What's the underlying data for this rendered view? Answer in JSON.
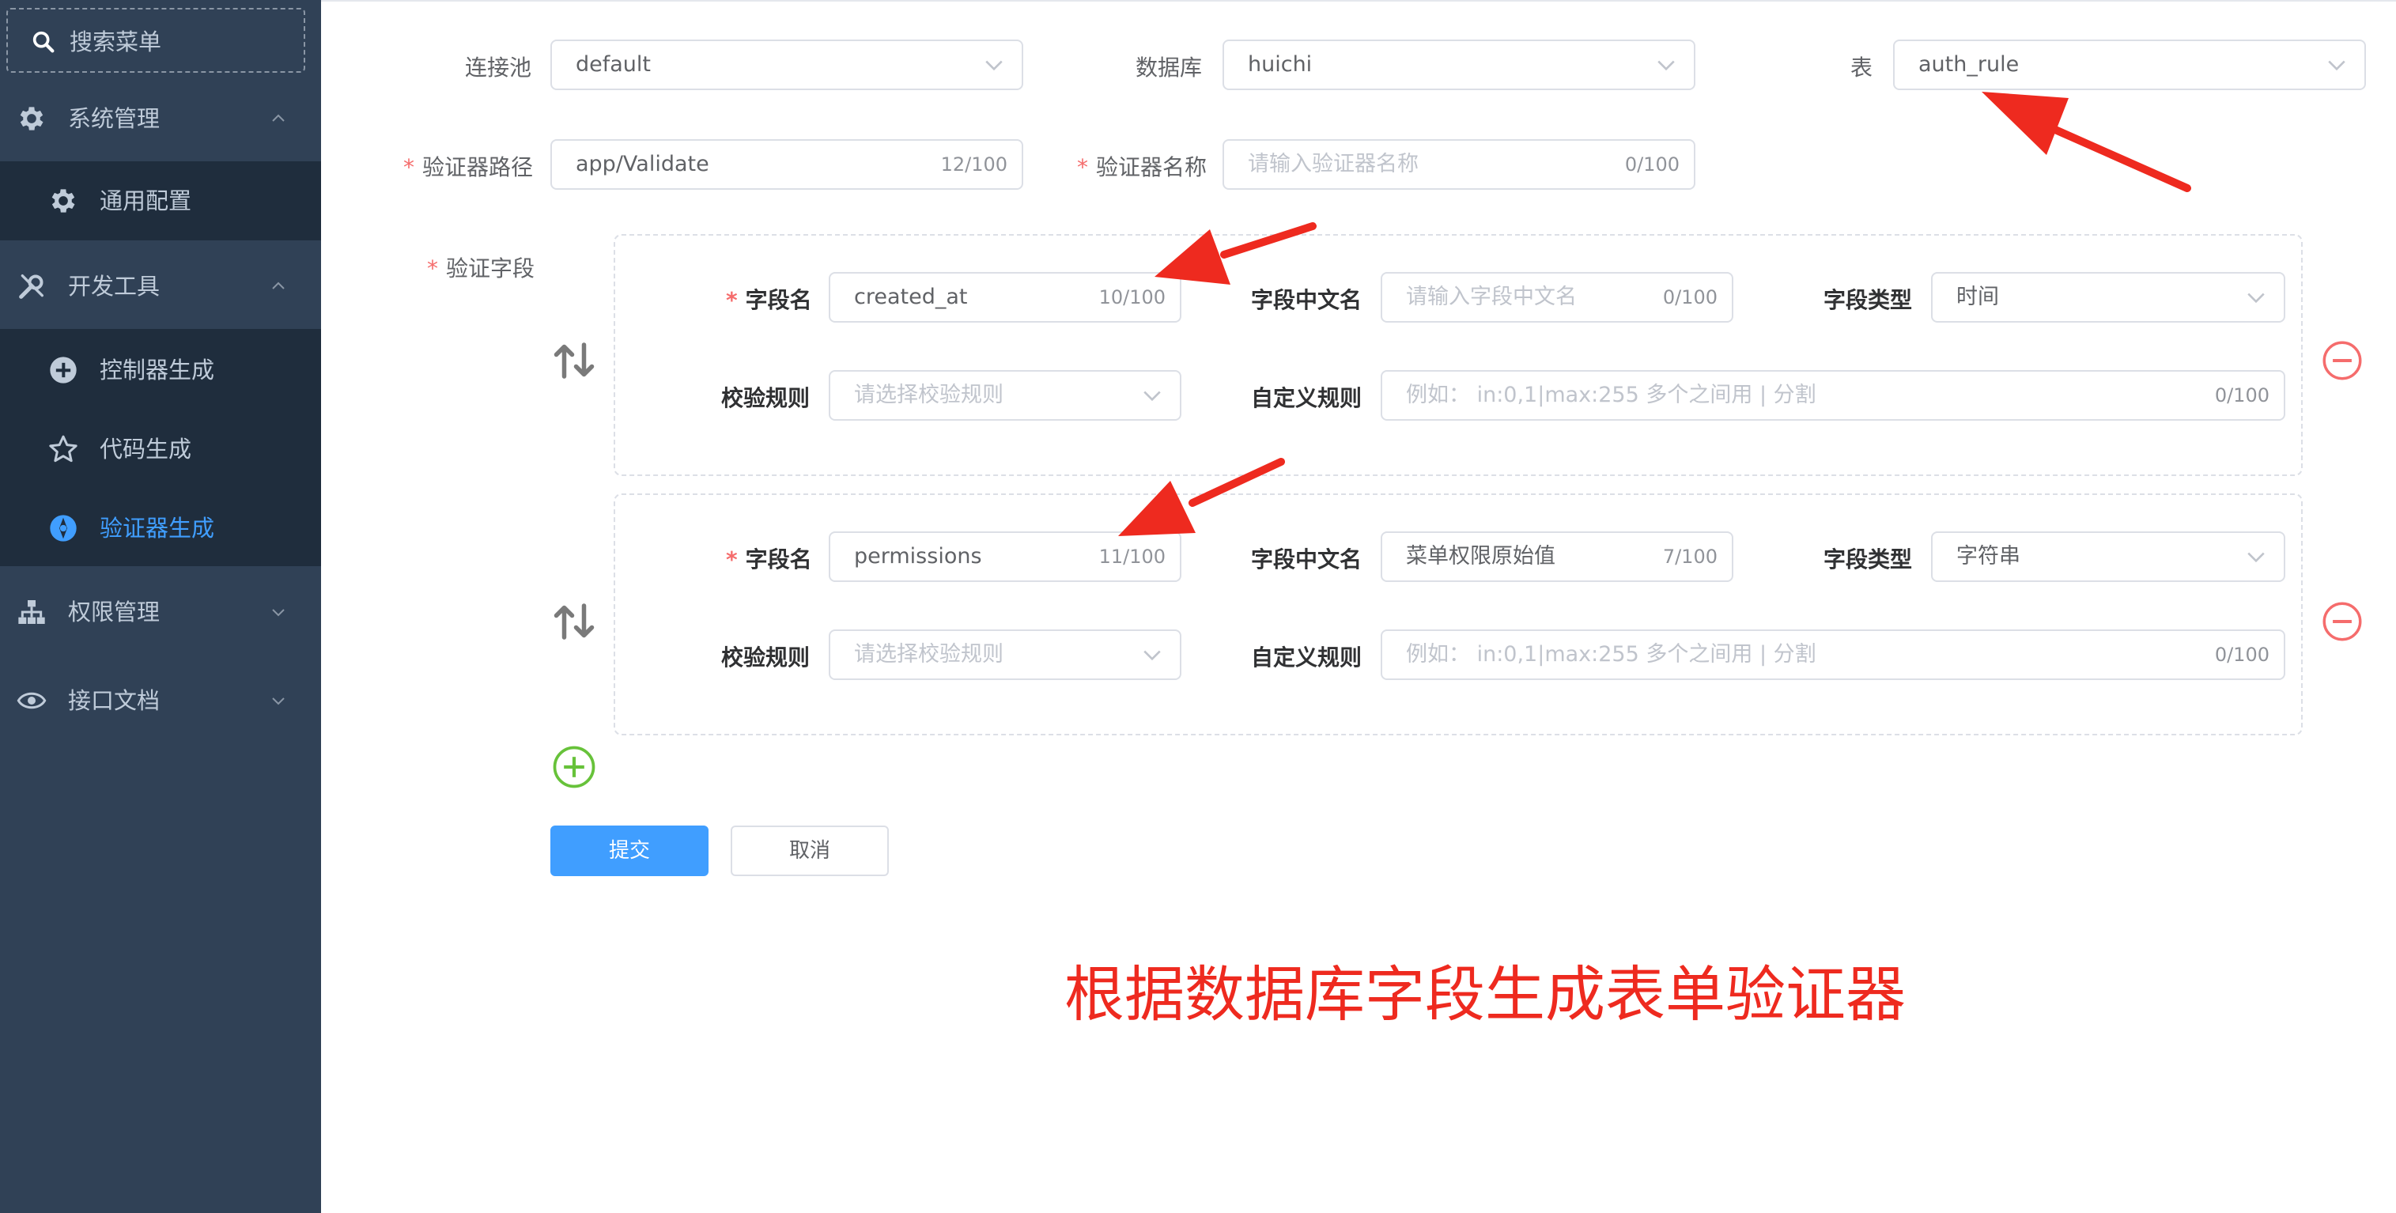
{
  "sidebar": {
    "search_placeholder": "搜索菜单",
    "menu": {
      "system": "系统管理",
      "general_config": "通用配置",
      "dev_tools": "开发工具",
      "controller_gen": "控制器生成",
      "code_gen": "代码生成",
      "validator_gen": "验证器生成",
      "permission": "权限管理",
      "api_docs": "接口文档"
    },
    "colors": {
      "background": "#304156",
      "submenu_background": "#1f2d3d",
      "text": "#bfcbd9",
      "active": "#409eff"
    }
  },
  "form": {
    "pool_label": "连接池",
    "pool_value": "default",
    "database_label": "数据库",
    "database_value": "huichi",
    "table_label": "表",
    "table_value": "auth_rule",
    "path_label": "验证器路径",
    "path_value": "app/Validate",
    "path_count": "12/100",
    "name_label": "验证器名称",
    "name_placeholder": "请输入验证器名称",
    "name_count": "0/100",
    "fields_label": "验证字段",
    "required_mark": "*",
    "fields": [
      {
        "field_name_label": "字段名",
        "field_name_value": "created_at",
        "field_name_count": "10/100",
        "cn_name_label": "字段中文名",
        "cn_name_value": "",
        "cn_name_placeholder": "请输入字段中文名",
        "cn_name_count": "0/100",
        "type_label": "字段类型",
        "type_value": "时间",
        "rule_label": "校验规则",
        "rule_placeholder": "请选择校验规则",
        "custom_label": "自定义规则",
        "custom_placeholder": "例如： in:0,1|max:255 多个之间用 | 分割",
        "custom_count": "0/100"
      },
      {
        "field_name_label": "字段名",
        "field_name_value": "permissions",
        "field_name_count": "11/100",
        "cn_name_label": "字段中文名",
        "cn_name_value": "菜单权限原始值",
        "cn_name_placeholder": "",
        "cn_name_count": "7/100",
        "type_label": "字段类型",
        "type_value": "字符串",
        "rule_label": "校验规则",
        "rule_placeholder": "请选择校验规则",
        "custom_label": "自定义规则",
        "custom_placeholder": "例如： in:0,1|max:255 多个之间用 | 分割",
        "custom_count": "0/100"
      }
    ],
    "submit": "提交",
    "cancel": "取消"
  },
  "caption": "根据数据库字段生成表单验证器",
  "colors": {
    "primary": "#409eff",
    "danger": "#f56c6c",
    "success": "#67c23a",
    "annotation": "#ee2a1f"
  }
}
